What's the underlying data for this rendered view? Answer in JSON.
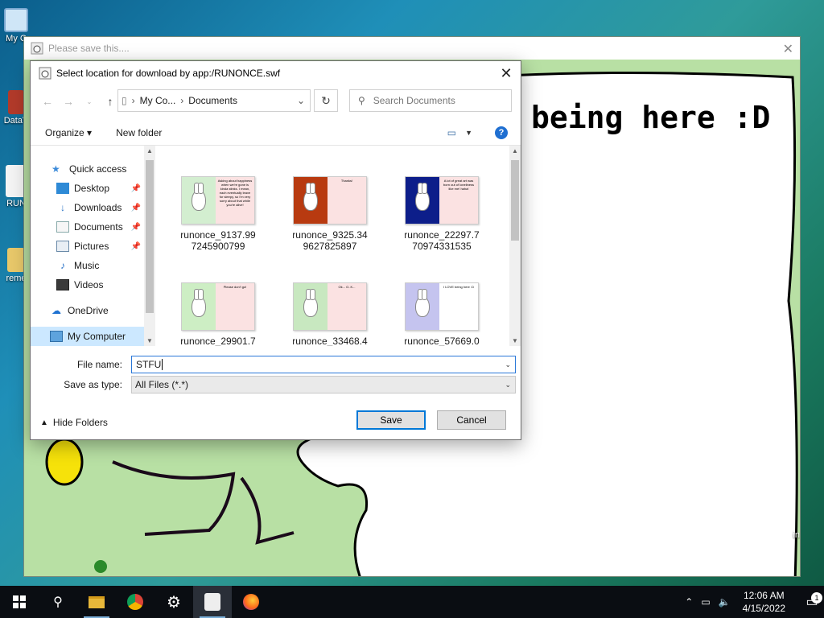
{
  "desktop": {
    "icons": [
      {
        "label": "My C",
        "icon": "computer-icon"
      },
      {
        "label": "DataV",
        "icon": "app-icon"
      },
      {
        "label": "RUN",
        "icon": "flash-app-icon"
      },
      {
        "label": "reme",
        "icon": "folder-icon"
      }
    ]
  },
  "app_window": {
    "title": "Please save this....",
    "speech_text": "being here :D",
    "right_edge_text": "in"
  },
  "dialog": {
    "title": "Select location for download by app:/RUNONCE.swf",
    "address": {
      "root": "My Co...",
      "current": "Documents"
    },
    "search_placeholder": "Search Documents",
    "toolbar": {
      "organize": "Organize",
      "new_folder": "New folder"
    },
    "nav": {
      "quick_access": "Quick access",
      "items": [
        {
          "label": "Desktop",
          "icon": "desktop-icon",
          "pinned": true
        },
        {
          "label": "Downloads",
          "icon": "downloads-icon",
          "pinned": true
        },
        {
          "label": "Documents",
          "icon": "documents-icon",
          "pinned": true
        },
        {
          "label": "Pictures",
          "icon": "pictures-icon",
          "pinned": true
        },
        {
          "label": "Music",
          "icon": "music-icon",
          "pinned": false
        },
        {
          "label": "Videos",
          "icon": "videos-icon",
          "pinned": false
        }
      ],
      "onedrive": "OneDrive",
      "my_computer": "My Computer"
    },
    "files": [
      {
        "name_line1": "runonce_9137.99",
        "name_line2": "7245900799",
        "bg": "#d3eed0",
        "caption": "Asking about happiness when we're gone is kinda stinks. I mean, each eventually leave for sleepy, so I'm very sorry about that while you're alive!"
      },
      {
        "name_line1": "runonce_9325.34",
        "name_line2": "9627825897",
        "bg": "#b83a10",
        "caption": "Thanks!"
      },
      {
        "name_line1": "runonce_22297.7",
        "name_line2": "70974331535",
        "bg": "#0d1e8a",
        "caption": "A lot of great art was born out of loneliness like me! haha!"
      },
      {
        "name_line1": "runonce_29901.7",
        "name_line2": "",
        "bg": "#cdeec4",
        "caption": "Please don't go!"
      },
      {
        "name_line1": "runonce_33468.4",
        "name_line2": "",
        "bg": "#c8e8c0",
        "caption": "Ok... O..K..."
      },
      {
        "name_line1": "runonce_57669.0",
        "name_line2": "",
        "bg": "#c5c4ef",
        "caption": "I LOVE being here :D"
      }
    ],
    "file_name_label": "File name:",
    "file_name_value": "STFU",
    "save_type_label": "Save as type:",
    "save_type_value": "All Files (*.*)",
    "hide_folders": "Hide Folders",
    "save_button": "Save",
    "cancel_button": "Cancel"
  },
  "taskbar": {
    "time": "12:06 AM",
    "date": "4/15/2022",
    "notification_count": "1"
  }
}
